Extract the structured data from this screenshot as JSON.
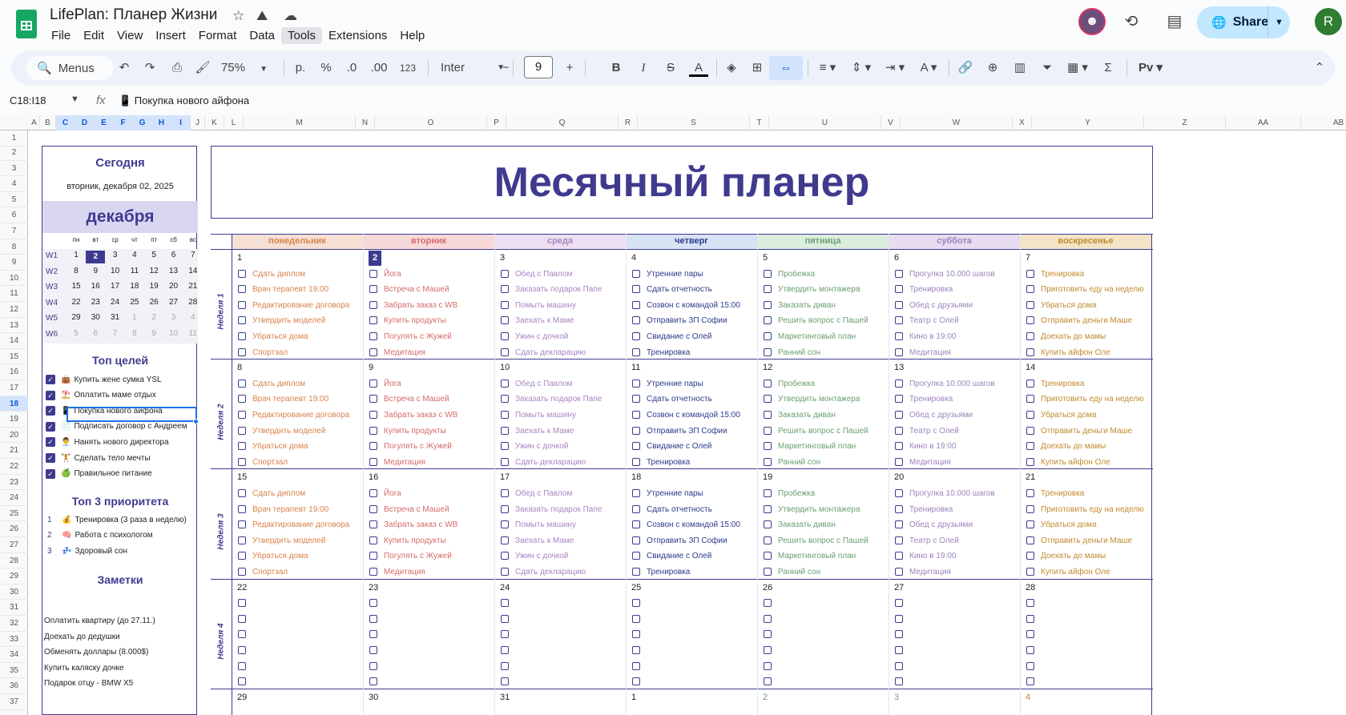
{
  "doc": {
    "title": "LifePlan: Планер Жизни"
  },
  "menubar": [
    "File",
    "Edit",
    "View",
    "Insert",
    "Format",
    "Data",
    "Tools",
    "Extensions",
    "Help"
  ],
  "header": {
    "share_label": "Share",
    "user_initial": "R"
  },
  "toolbar": {
    "search_label": "Menus",
    "zoom": "75%",
    "currency": "р.",
    "percent": "%",
    "dec_dec": ".0",
    "dec_inc": ".00",
    "number_fmt": "123",
    "font": "Inter",
    "font_size": "9"
  },
  "formula_bar": {
    "range": "C18:I18",
    "content": "📱 Покупка нового айфона"
  },
  "columns": [
    "A",
    "B",
    "C",
    "D",
    "E",
    "F",
    "G",
    "H",
    "I",
    "J",
    "K",
    "L",
    "M",
    "N",
    "O",
    "P",
    "Q",
    "R",
    "S",
    "T",
    "U",
    "V",
    "W",
    "X",
    "Y",
    "Z",
    "AA",
    "AB"
  ],
  "selected_columns": [
    "C",
    "D",
    "E",
    "F",
    "G",
    "H",
    "I"
  ],
  "selected_row": "18",
  "sidebar": {
    "today_title": "Сегодня",
    "today_date": "вторник, декабря 02, 2025",
    "month": "декабря",
    "weekdays": [
      "пн",
      "вт",
      "ср",
      "чт",
      "пт",
      "сб",
      "вс"
    ],
    "weeks": [
      {
        "label": "W1",
        "days": [
          "1",
          "2",
          "3",
          "4",
          "5",
          "6",
          "7"
        ]
      },
      {
        "label": "W2",
        "days": [
          "8",
          "9",
          "10",
          "11",
          "12",
          "13",
          "14"
        ]
      },
      {
        "label": "W3",
        "days": [
          "15",
          "16",
          "17",
          "18",
          "19",
          "20",
          "21"
        ]
      },
      {
        "label": "W4",
        "days": [
          "22",
          "23",
          "24",
          "25",
          "26",
          "27",
          "28"
        ]
      },
      {
        "label": "W5",
        "days": [
          "29",
          "30",
          "31",
          "1",
          "2",
          "3",
          "4"
        ]
      },
      {
        "label": "W6",
        "days": [
          "5",
          "6",
          "7",
          "8",
          "9",
          "10",
          "11"
        ]
      }
    ],
    "goals_title": "Топ целей",
    "goals": [
      {
        "icon": "👜",
        "text": "Купить жене сумка YSL"
      },
      {
        "icon": "⛱️",
        "text": "Оплатить маме отдых"
      },
      {
        "icon": "📱",
        "text": "Покупка нового айфона"
      },
      {
        "icon": "📄",
        "text": "Подписать договор с Андреем"
      },
      {
        "icon": "👨‍💼",
        "text": "Нанять нового директора"
      },
      {
        "icon": "🏋️",
        "text": "Сделать тело мечты"
      },
      {
        "icon": "🍏",
        "text": "Правильное питание"
      }
    ],
    "priorities_title": "Топ 3 приоритета",
    "priorities": [
      {
        "n": "1",
        "icon": "💰",
        "text": "Тренировка (3 раза в неделю)"
      },
      {
        "n": "2",
        "icon": "🧠",
        "text": "Работа с психологом"
      },
      {
        "n": "3",
        "icon": "💤",
        "text": "Здоровый сон"
      }
    ],
    "notes_title": "Заметки",
    "notes": [
      "Оплатить квартиру (до 27.11.)",
      "Доехать до дедушки",
      "Обменять доллары (8.000$)",
      "Купить каляску дочке",
      "Подарок отцу - BMW X5"
    ]
  },
  "planner": {
    "title": "Месячный планер",
    "days": [
      {
        "name": "понедельник",
        "bg": "#f6dfd3",
        "fg": "#d9824a"
      },
      {
        "name": "вторник",
        "bg": "#f8d9d9",
        "fg": "#d66a6a"
      },
      {
        "name": "среда",
        "bg": "#ece0f2",
        "fg": "#a885c2"
      },
      {
        "name": "четверг",
        "bg": "#d7e3f5",
        "fg": "#2b3a8a"
      },
      {
        "name": "пятница",
        "bg": "#dcecdd",
        "fg": "#6aa072"
      },
      {
        "name": "суббота",
        "bg": "#e7dcf0",
        "fg": "#9c84bc"
      },
      {
        "name": "воскресенье",
        "bg": "#f3e4c6",
        "fg": "#c28a2e"
      }
    ],
    "tasks": [
      [
        "Сдать диплом",
        "Врач терапевт 19:00",
        "Редактирование договора",
        "Утвердить моделей",
        "Убраться дома",
        "Спортзал"
      ],
      [
        "Йога",
        "Встреча с Машей",
        "Забрать заказ с WB",
        "Купить продукты",
        "Погулять с Жужей",
        "Медитация"
      ],
      [
        "Обед с Павлом",
        "Заказать подарок Папе",
        "Помыть машину",
        "Заехать к Маме",
        "Ужин с дочкой",
        "Сдать декларацию"
      ],
      [
        "Утренние пары",
        "Сдать отчетность",
        "Созвон с командой 15:00",
        "Отправить ЗП Софии",
        "Свидание с Олей",
        "Тренировка"
      ],
      [
        "Пробежка",
        "Утвердить монтажера",
        "Заказать диван",
        "Решить вопрос с Пашей",
        "Маркетинговый план",
        "Ранний сон"
      ],
      [
        "Прогулка 10.000 шагов",
        "Тренировка",
        "Обед с друзьями",
        "Театр с Олей",
        "Кино в 19:00",
        "Медитация"
      ],
      [
        "Тренировка",
        "Приготовить еду на неделю",
        "Убраться дома",
        "Отправить деньги Маше",
        "Доехать до мамы",
        "Купить айфон Оле"
      ]
    ],
    "weeks": [
      {
        "label": "Неделя 1",
        "dates": [
          "1",
          "2",
          "3",
          "4",
          "5",
          "6",
          "7"
        ],
        "filled": true
      },
      {
        "label": "Неделя 2",
        "dates": [
          "8",
          "9",
          "10",
          "11",
          "12",
          "13",
          "14"
        ],
        "filled": true
      },
      {
        "label": "Неделя 3",
        "dates": [
          "15",
          "16",
          "17",
          "18",
          "19",
          "20",
          "21"
        ],
        "filled": true
      },
      {
        "label": "Неделя 4",
        "dates": [
          "22",
          "23",
          "24",
          "25",
          "26",
          "27",
          "28"
        ],
        "filled": false
      },
      {
        "label": "",
        "dates": [
          "29",
          "30",
          "31",
          "1",
          "2",
          "3",
          "4"
        ],
        "filled": false
      }
    ],
    "today_date": "2"
  }
}
